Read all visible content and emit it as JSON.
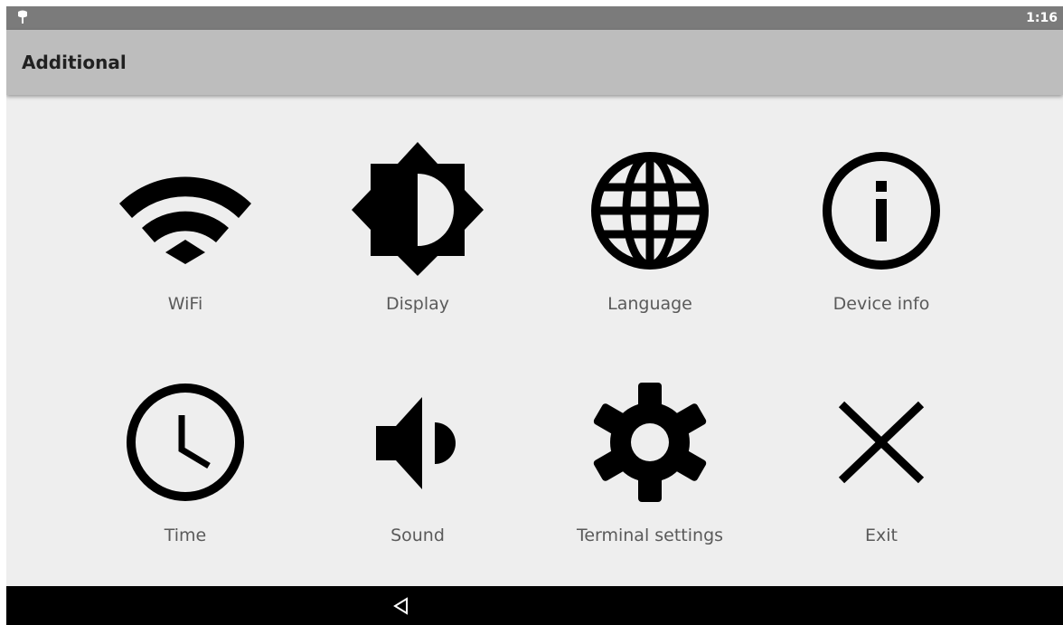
{
  "status_bar": {
    "time": "1:16",
    "left_icon": "android-debug-icon"
  },
  "app_bar": {
    "title": "Additional"
  },
  "tiles": [
    {
      "label": "WiFi",
      "icon": "wifi-icon"
    },
    {
      "label": "Display",
      "icon": "brightness-icon"
    },
    {
      "label": "Language",
      "icon": "globe-icon"
    },
    {
      "label": "Device info",
      "icon": "info-icon"
    },
    {
      "label": "Time",
      "icon": "clock-icon"
    },
    {
      "label": "Sound",
      "icon": "speaker-icon"
    },
    {
      "label": "Terminal settings",
      "icon": "gear-icon"
    },
    {
      "label": "Exit",
      "icon": "close-icon"
    }
  ],
  "nav_bar": {
    "back_icon": "back-triangle-icon"
  }
}
